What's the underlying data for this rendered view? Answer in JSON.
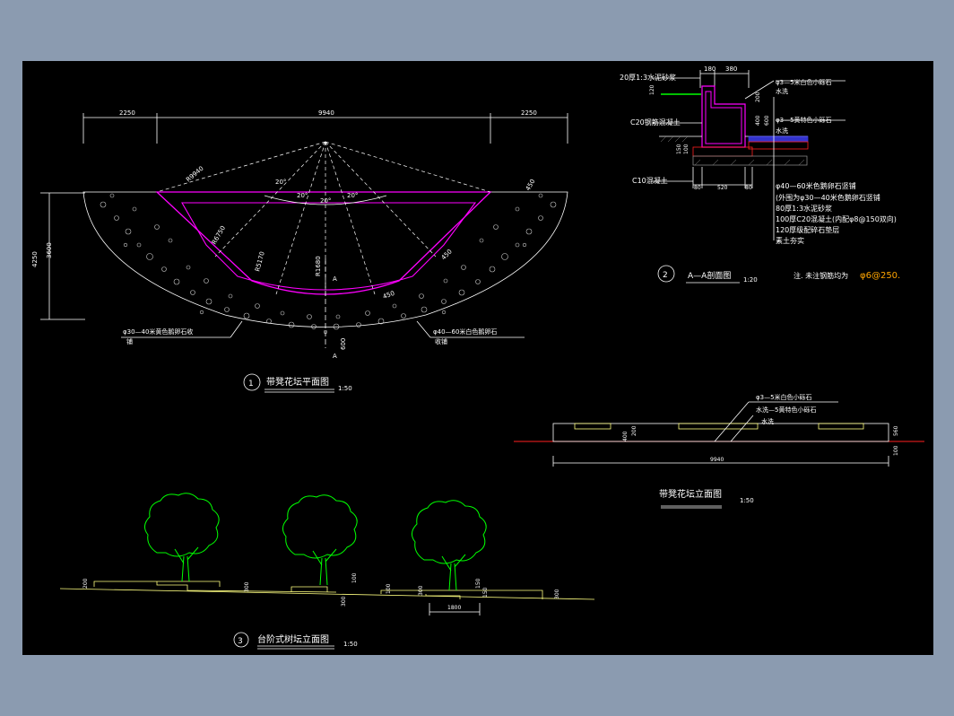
{
  "plan": {
    "dim_left": "2250",
    "dim_mid": "9940",
    "dim_right": "2250",
    "dim_total_h": "4250",
    "dim_inner_h": "3600",
    "radius_outer": "R9940",
    "radius_mid": "R6750",
    "radius_inner1": "R5170",
    "radius_inner2": "R1680",
    "angle_20a": "20°",
    "angle_20b": "20°",
    "angle_20c": "20°",
    "angle_20d": "20°",
    "dim_width": "450",
    "dim_width2": "450",
    "dim_600": "600",
    "dim_450b": "450",
    "section_a_top": "A",
    "section_a_bottom": "A",
    "label_left_l1": "φ30—40米黄色鹅卵石收",
    "label_left_l2": "铺",
    "label_right_l1": "φ40—60米白色鹅卵石",
    "label_right_l2": "收铺",
    "title_num": "1",
    "title": "带凳花坛平面图",
    "scale": "1:50"
  },
  "section": {
    "top_dims": [
      "180",
      "380"
    ],
    "label_20": "20厚1:3水泥砂浆",
    "label_c20": "C20钢筋混凝土",
    "label_c10": "C10混凝土",
    "dim_120": "120",
    "dim_200": "200",
    "dim_600": "600",
    "dim_400": "400",
    "dim_150": "150",
    "dim_100": "100",
    "bottom_dims": [
      "80",
      "520",
      "80"
    ],
    "right_labels": [
      "φ3—5米白色小砾石",
      "水洗",
      "φ3—5黄特色小砾石",
      "水洗"
    ],
    "layer_labels": [
      "φ40—60米色鹅卵石竖铺",
      "(外围为φ30—40米色鹅卵石竖铺",
      "80厚1:3水泥砂浆",
      "100厚C20混凝土(内配φ8@150双向)",
      "120厚级配碎石垫层",
      "素土夯实"
    ],
    "title_num": "2",
    "title": "A—A剖面图",
    "scale": "1:20",
    "note_prefix": "注. 未注钢筋均为",
    "note_value": "φ6@250."
  },
  "elevation": {
    "label1": "φ3—5米白色小砾石",
    "label2": "水洗—5黄特色小砾石",
    "label3": "水洗",
    "dim_bottom": "9940",
    "dim_200": "200",
    "dim_400": "400",
    "dim_560": "560",
    "dim_100": "100",
    "title": "带凳花坛立面图",
    "scale": "1:50"
  },
  "stepped": {
    "dims": [
      "200",
      "300",
      "300",
      "100",
      "100",
      "300",
      "150",
      "150",
      "300"
    ],
    "dim_bottom": "1800",
    "title_num": "3",
    "title": "台阶式树坛立面图",
    "scale": "1:50"
  },
  "colors": {
    "bg": "#000000",
    "frame": "#8b9bb0",
    "magenta": "#ff00ff",
    "tree": "#00ff00",
    "accent": "#ffa500",
    "yellow": "#ffff80",
    "red": "#ff2020",
    "blue": "#4040ff"
  }
}
